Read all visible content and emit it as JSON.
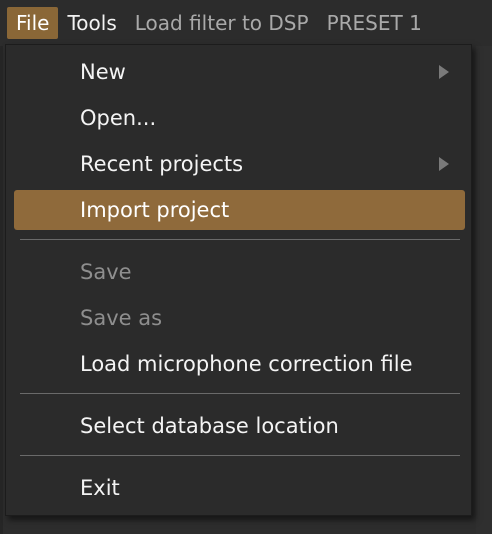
{
  "menubar": {
    "items": [
      {
        "label": "File"
      },
      {
        "label": "Tools"
      },
      {
        "label": "Load filter to DSP"
      },
      {
        "label": "PRESET 1"
      }
    ]
  },
  "file_menu": {
    "new": "New",
    "open": "Open...",
    "recent_projects": "Recent projects",
    "import_project": "Import project",
    "save": "Save",
    "save_as": "Save as",
    "load_mic_correction": "Load microphone correction file",
    "select_db_location": "Select database location",
    "exit": "Exit"
  },
  "colors": {
    "accent": "#8f6a3b",
    "menu_bg": "#2b2b2b",
    "text": "#f4f4f4",
    "disabled_text": "#8e8e8e"
  }
}
